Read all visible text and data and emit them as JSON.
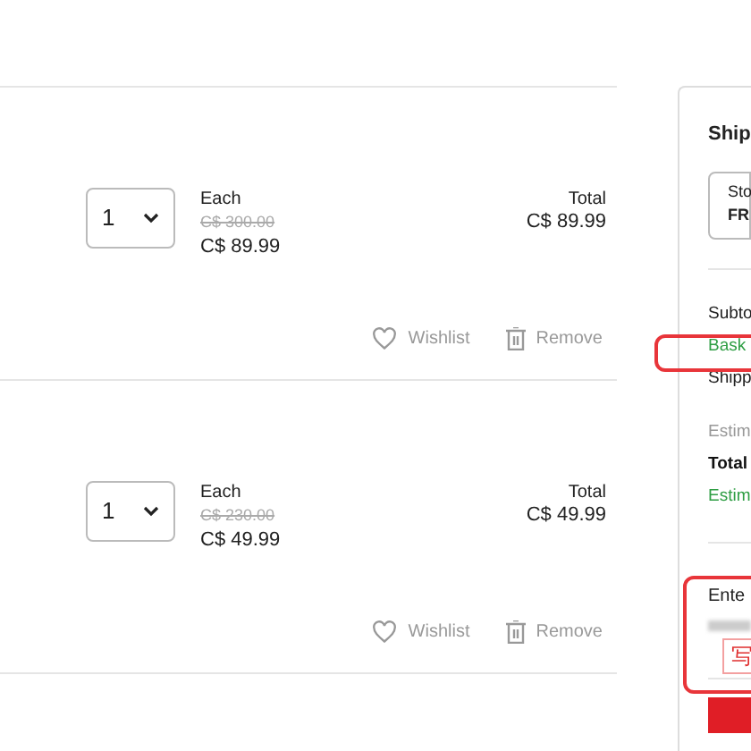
{
  "basket_items": [
    {
      "quantity": "1",
      "each_label": "Each",
      "old_price": "C$ 300.00",
      "price": "C$ 89.99",
      "total_label": "Total",
      "total": "C$ 89.99",
      "wishlist": "Wishlist",
      "remove": "Remove"
    },
    {
      "quantity": "1",
      "each_label": "Each",
      "old_price": "C$ 230.00",
      "price": "C$ 49.99",
      "total_label": "Total",
      "total": "C$ 49.99",
      "wishlist": "Wishlist",
      "remove": "Remove"
    }
  ],
  "summary": {
    "title": "Ship",
    "option": {
      "line_1": "Sto",
      "line_2": "FR"
    },
    "lines": [
      {
        "text": "Subto",
        "kind": "plain"
      },
      {
        "text": "Bask",
        "kind": "green"
      },
      {
        "text": "Shipp",
        "kind": "plain"
      },
      {
        "text": "Estim",
        "kind": "muted"
      },
      {
        "text": "Total",
        "kind": "bold"
      },
      {
        "text": "Estim",
        "kind": "green"
      }
    ],
    "code_label": "Ente",
    "code_button": "写"
  }
}
